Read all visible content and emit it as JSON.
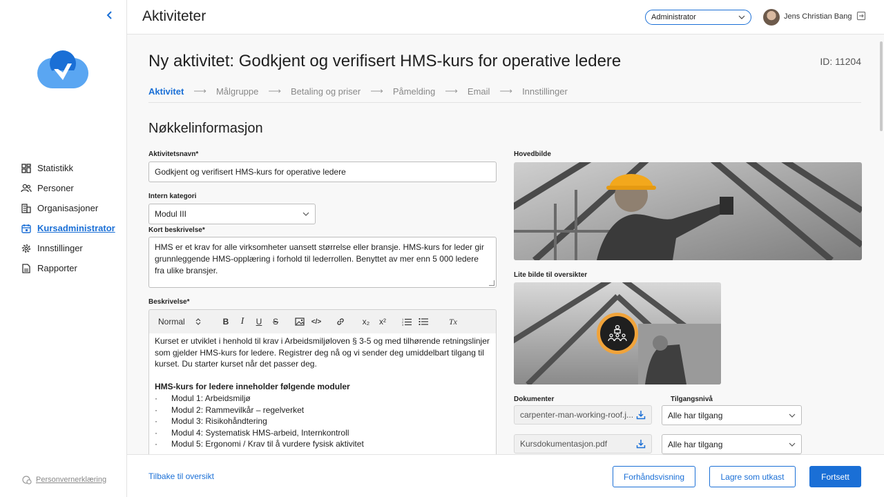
{
  "sidebar": {
    "items": [
      {
        "label": "Statistikk",
        "icon": "dashboard-icon"
      },
      {
        "label": "Personer",
        "icon": "people-icon"
      },
      {
        "label": "Organisasjoner",
        "icon": "building-icon"
      },
      {
        "label": "Kursadministrator",
        "icon": "calendar-icon"
      },
      {
        "label": "Innstillinger",
        "icon": "gear-icon"
      },
      {
        "label": "Rapporter",
        "icon": "report-icon"
      }
    ],
    "active_index": 3,
    "privacy_label": "Personvernerklæring"
  },
  "header": {
    "title": "Aktiviteter",
    "role": "Administrator",
    "user_name": "Jens Christian Bang"
  },
  "page": {
    "title": "Ny aktivitet: Godkjent og verifisert HMS-kurs for operative ledere",
    "id_label": "ID: 11204",
    "steps": [
      "Aktivitet",
      "Målgruppe",
      "Betaling og priser",
      "Påmelding",
      "Email",
      "Innstillinger"
    ],
    "arrow": "⟶",
    "section_title": "Nøkkelinformasjon"
  },
  "form": {
    "name_label": "Aktivitetsnavn*",
    "name_value": "Godkjent og verifisert HMS-kurs for operative ledere",
    "category_label": "Intern kategori",
    "category_value": "Modul III",
    "short_desc_label": "Kort beskrivelse*",
    "short_desc_value": "HMS er et krav for alle virksomheter uansett størrelse eller bransje. HMS-kurs for leder gir grunnleggende HMS-opplæring i forhold til lederrollen. Benyttet av mer enn 5 000 ledere fra ulike bransjer.",
    "desc_label": "Beskrivelse*",
    "toolbar": {
      "style_value": "Normal",
      "bold": "B",
      "italic": "I",
      "underline": "U",
      "strike": "S",
      "code": "</>",
      "subscript": "x₂",
      "superscript": "x²",
      "clear": "Tx"
    },
    "editor": {
      "intro": "Kurset er utviklet i henhold til krav i Arbeidsmiljøloven § 3-5 og med tilhørende retningslinjer som gjelder HMS-kurs for ledere. Registrer deg nå og vi sender deg umiddelbart tilgang til kurset. Du starter kurset når det passer deg.",
      "heading": "HMS-kurs for ledere inneholder følgende moduler",
      "bullet": "·",
      "modules": [
        "Modul 1: Arbeidsmiljø",
        "Modul 2: Rammevilkår – regelverket",
        "Modul 3: Risikohåndtering",
        "Modul 4: Systematisk HMS-arbeid, Internkontroll",
        "Modul 5: Ergonomi / Krav til å vurdere fysisk aktivitet"
      ]
    }
  },
  "media": {
    "main_image_label": "Hovedbilde",
    "small_image_label": "Lite bilde til oversikter",
    "documents_label": "Dokumenter",
    "access_label": "Tilgangsnivå",
    "documents": [
      {
        "name": "carpenter-man-working-roof.j...",
        "access": "Alle har tilgang"
      },
      {
        "name": "Kursdokumentasjon.pdf",
        "access": "Alle har tilgang"
      }
    ]
  },
  "footer": {
    "back_label": "Tilbake til oversikt",
    "preview_label": "Forhåndsvisning",
    "draft_label": "Lagre som utkast",
    "continue_label": "Fortsett"
  },
  "colors": {
    "accent": "#1a6fd6",
    "badge_ring": "#f0a33a"
  }
}
